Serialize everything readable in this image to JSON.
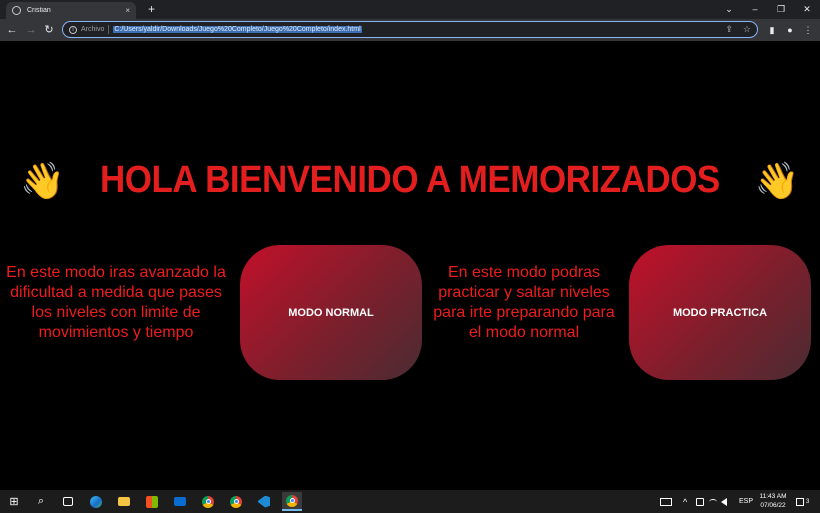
{
  "browser": {
    "tab_title": "Cristian",
    "tab_close": "×",
    "new_tab": "+",
    "window_controls": [
      "⌄",
      "–",
      "❐",
      "✕"
    ],
    "nav": {
      "back": "←",
      "forward": "→",
      "reload": "↻"
    },
    "omnibox": {
      "info": "i",
      "chip": "Archivo",
      "url": "C:/Users/yaldir/Downloads/Juego%20Completo/Juego%20Completo/index.html",
      "share": "⇪",
      "star": "☆"
    },
    "toolbar_icons": {
      "sidebar": "▮",
      "profile": "●",
      "menu": "⋮"
    }
  },
  "page": {
    "hand_left": "👋",
    "title": "HOLA BIENVENIDO A MEMORIZADOS",
    "hand_right": "👋",
    "normal_description": "En este modo iras avanzado la dificultad a medida que pases los niveles con limite de movimientos y tiempo",
    "normal_button": "MODO NORMAL",
    "practice_description": "En este modo podras practicar y saltar niveles para irte preparando para el modo normal",
    "practice_button": "MODO PRACTICA"
  },
  "taskbar": {
    "start": "⊞",
    "search": "⌕",
    "tray_language": "ESP",
    "tray_chevron": "^",
    "time": "11:43 AM",
    "date": "07/06/22",
    "notification_count": "3",
    "colors": {
      "accent": "#76b9ed"
    }
  },
  "colors": {
    "title": "#e31e1e",
    "description": "#f01c1c",
    "button_gradient_start": "#c2102a",
    "button_gradient_end": "#4a2c33"
  }
}
